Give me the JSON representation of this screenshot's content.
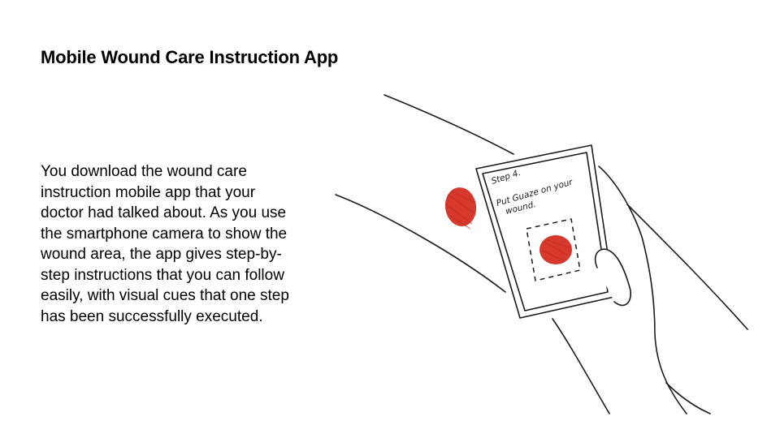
{
  "slide": {
    "title": "Mobile Wound Care Instruction App",
    "description": "You download the wound care instruction mobile app that your doctor had talked about. As you use the smartphone camera to show the wound area, the app gives step-by-step instructions that you can follow easily, with visual cues that one step has been successfully executed."
  },
  "phone_screen": {
    "step_label": "Step 4.",
    "instruction_line1": "Put Guaze on your",
    "instruction_line2": "wound."
  },
  "colors": {
    "wound": "#d6382b",
    "ink": "#1a1a1a"
  }
}
